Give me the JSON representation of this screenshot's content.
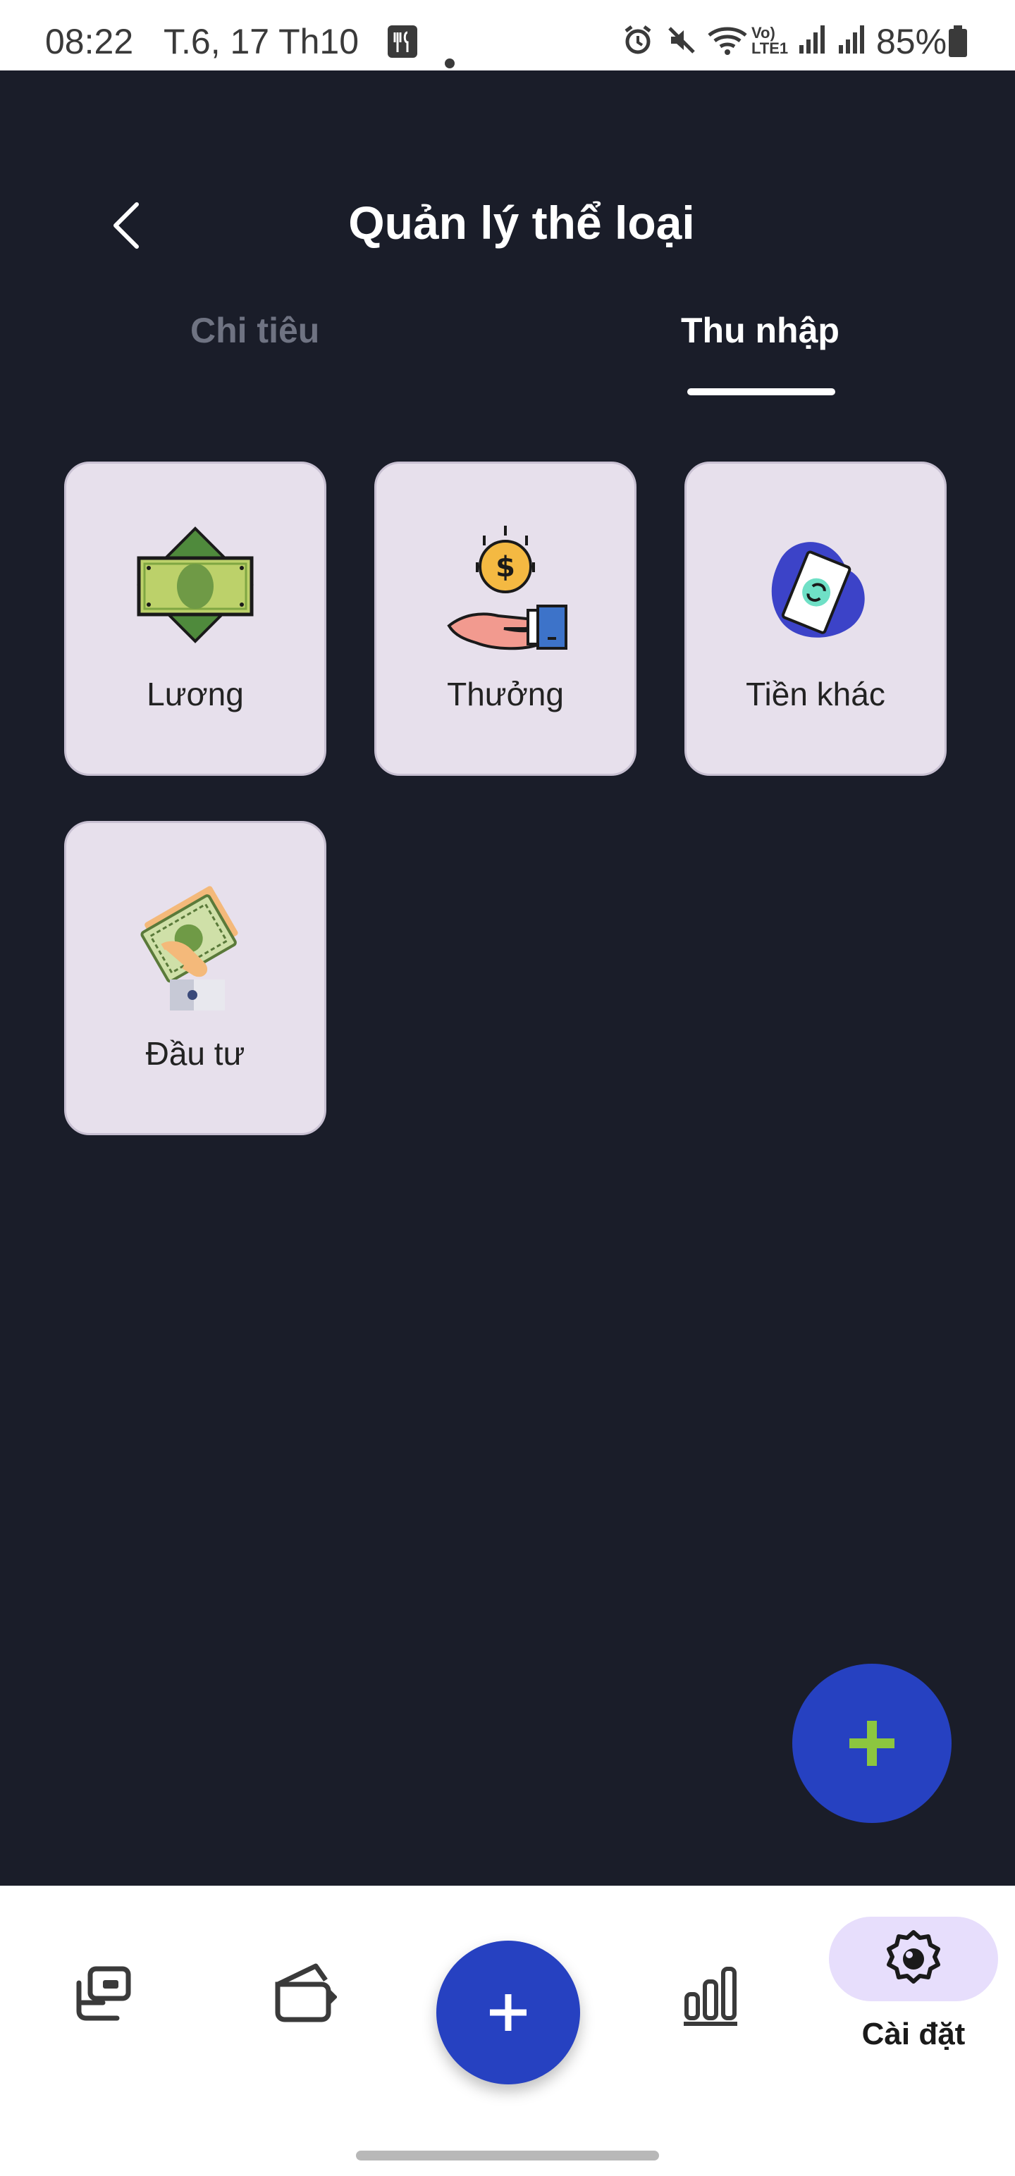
{
  "status_bar": {
    "time": "08:22",
    "date": "T.6, 17 Th10",
    "battery": "85%"
  },
  "header": {
    "title": "Quản lý thể loại"
  },
  "tabs": [
    {
      "label": "Chi tiêu",
      "active": false
    },
    {
      "label": "Thu nhập",
      "active": true
    }
  ],
  "categories": [
    {
      "label": "Lương",
      "icon": "money-bill-icon"
    },
    {
      "label": "Thưởng",
      "icon": "hand-coin-icon"
    },
    {
      "label": "Tiền khác",
      "icon": "banknote-blob-icon"
    },
    {
      "label": "Đầu tư",
      "icon": "hand-cash-icon"
    }
  ],
  "bottom_nav": {
    "items": [
      {
        "icon": "transactions-icon"
      },
      {
        "icon": "wallet-icon"
      },
      {
        "icon": "plus-icon"
      },
      {
        "icon": "bar-chart-icon"
      },
      {
        "icon": "settings-icon",
        "label": "Cài đặt",
        "active": true
      }
    ]
  },
  "colors": {
    "background": "#1a1d29",
    "card": "#e7e0ec",
    "accent_blue": "#2641c1",
    "fab_plus": "#8cc63f",
    "nav_active_pill": "#e7defc"
  }
}
